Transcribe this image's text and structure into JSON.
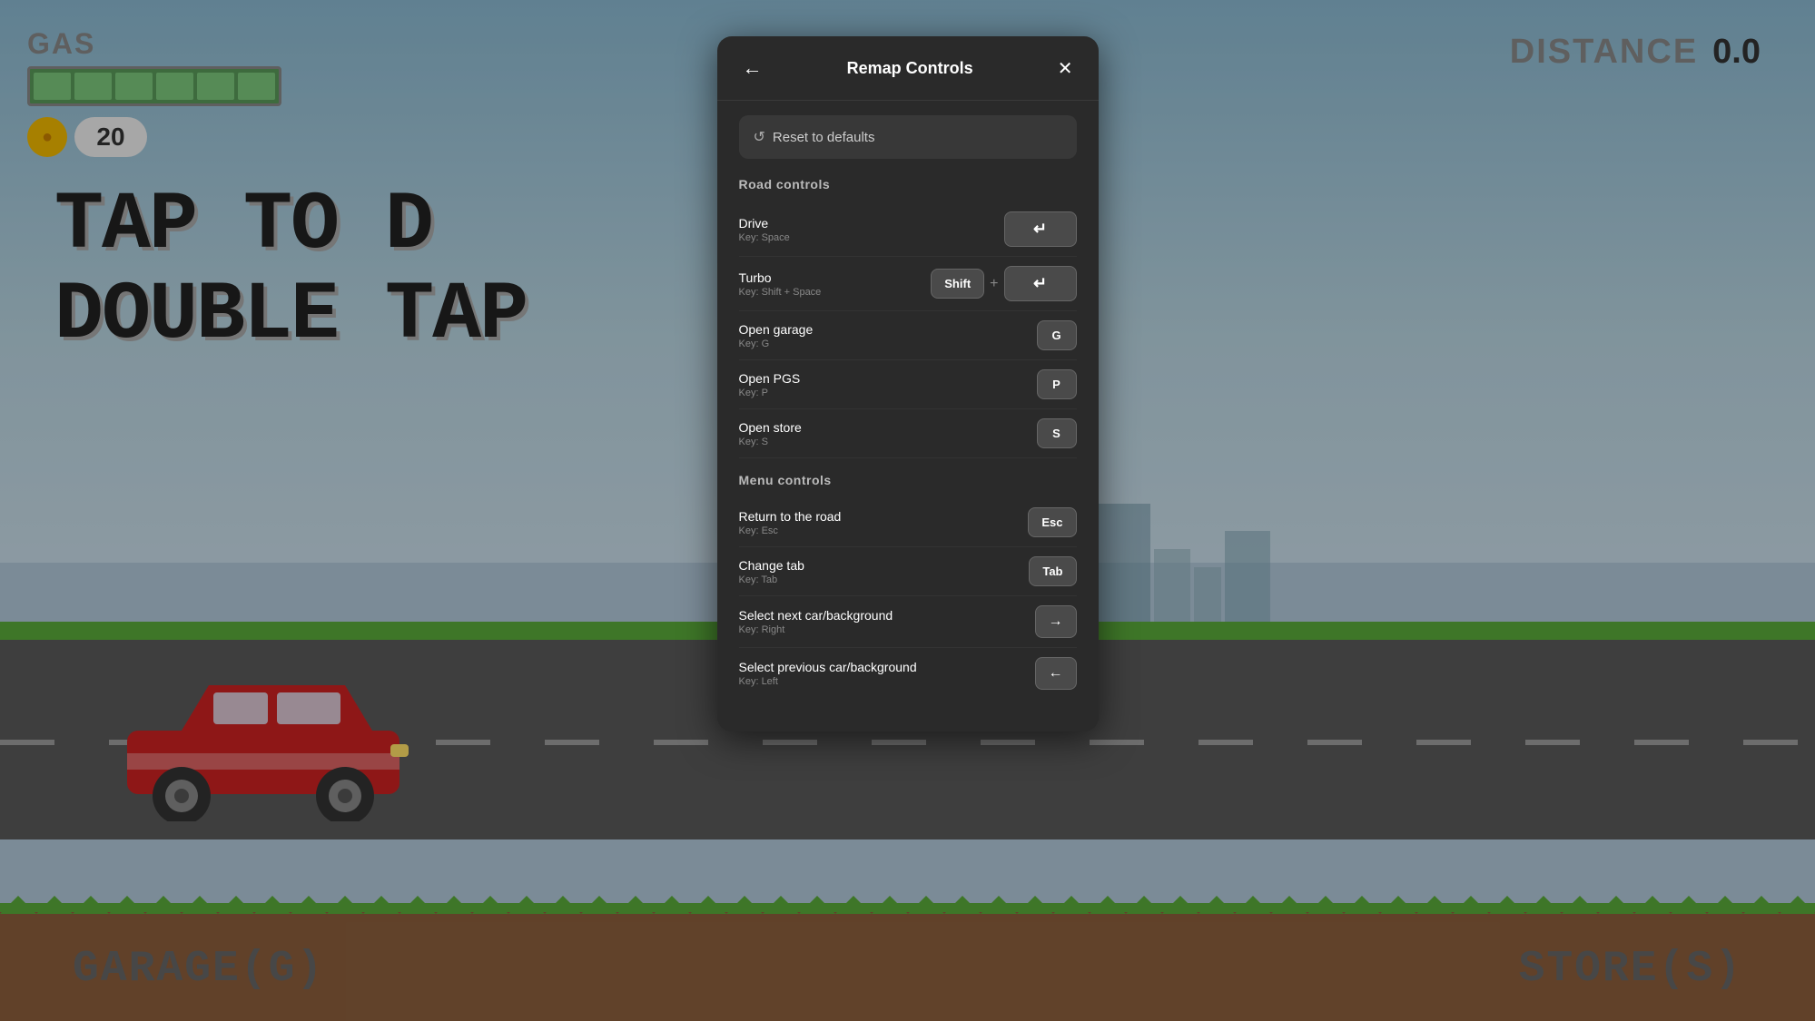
{
  "game": {
    "gas_label": "GAS",
    "distance_label": "DISTANCE",
    "distance_value": "0.0",
    "coin_count": "20",
    "tap_text_line1": "TAP TO D",
    "tap_text_line2": "DOUBLE TAP",
    "bottom_left": "GARAGE(G)",
    "bottom_right": "STORE(S)"
  },
  "modal": {
    "title": "Remap Controls",
    "back_label": "←",
    "close_label": "✕",
    "reset_label": "Reset to defaults",
    "reset_icon": "↺",
    "road_section": "Road controls",
    "menu_section": "Menu controls",
    "controls": {
      "road": [
        {
          "name": "Drive",
          "key_hint": "Key: Space",
          "keys": [
            {
              "label": "↵",
              "type": "enter"
            }
          ]
        },
        {
          "name": "Turbo",
          "key_hint": "Key: Shift + Space",
          "keys": [
            {
              "label": "Shift",
              "type": "normal"
            },
            {
              "label": "+",
              "type": "plus"
            },
            {
              "label": "↵",
              "type": "enter"
            }
          ]
        },
        {
          "name": "Open garage",
          "key_hint": "Key: G",
          "keys": [
            {
              "label": "G",
              "type": "normal"
            }
          ]
        },
        {
          "name": "Open PGS",
          "key_hint": "Key: P",
          "keys": [
            {
              "label": "P",
              "type": "normal"
            }
          ]
        },
        {
          "name": "Open store",
          "key_hint": "Key: S",
          "keys": [
            {
              "label": "S",
              "type": "normal"
            }
          ]
        }
      ],
      "menu": [
        {
          "name": "Return to the road",
          "key_hint": "Key: Esc",
          "keys": [
            {
              "label": "Esc",
              "type": "normal"
            }
          ]
        },
        {
          "name": "Change tab",
          "key_hint": "Key: Tab",
          "keys": [
            {
              "label": "Tab",
              "type": "normal"
            }
          ]
        },
        {
          "name": "Select next car/background",
          "key_hint": "Key: Right",
          "keys": [
            {
              "label": "→",
              "type": "arrow"
            }
          ]
        },
        {
          "name": "Select previous car/background",
          "key_hint": "Key: Left",
          "keys": [
            {
              "label": "←",
              "type": "arrow"
            }
          ]
        }
      ]
    }
  }
}
